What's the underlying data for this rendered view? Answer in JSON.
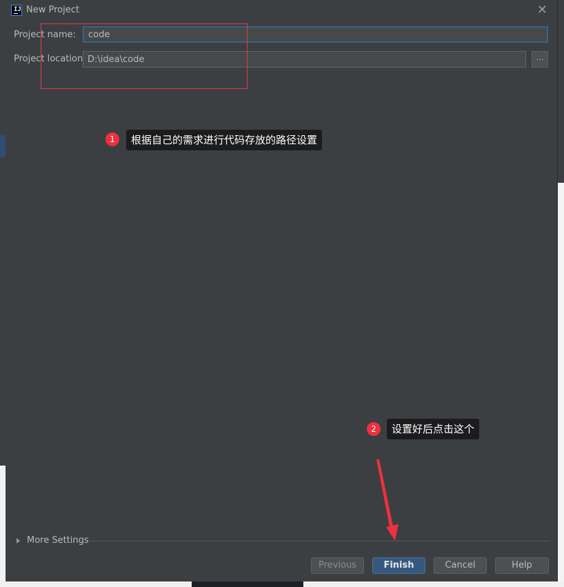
{
  "window": {
    "title": "New Project",
    "icon_text": "IJ",
    "close_glyph": "✕"
  },
  "form": {
    "name_label": "Project name:",
    "name_value": "code",
    "location_label": "Project location:",
    "location_value": "D:\\idea\\code",
    "browse_label": "..."
  },
  "annotations": [
    {
      "number": "1",
      "text": "根据自己的需求进行代码存放的路径设置"
    },
    {
      "number": "2",
      "text": "设置好后点击这个"
    }
  ],
  "more_settings": {
    "label": "More Settings"
  },
  "buttons": {
    "previous": "Previous",
    "finish": "Finish",
    "cancel": "Cancel",
    "help": "Help"
  },
  "colors": {
    "dialog_bg": "#3c3f41",
    "annotation_red": "#f0303f",
    "primary_button": "#365880"
  }
}
